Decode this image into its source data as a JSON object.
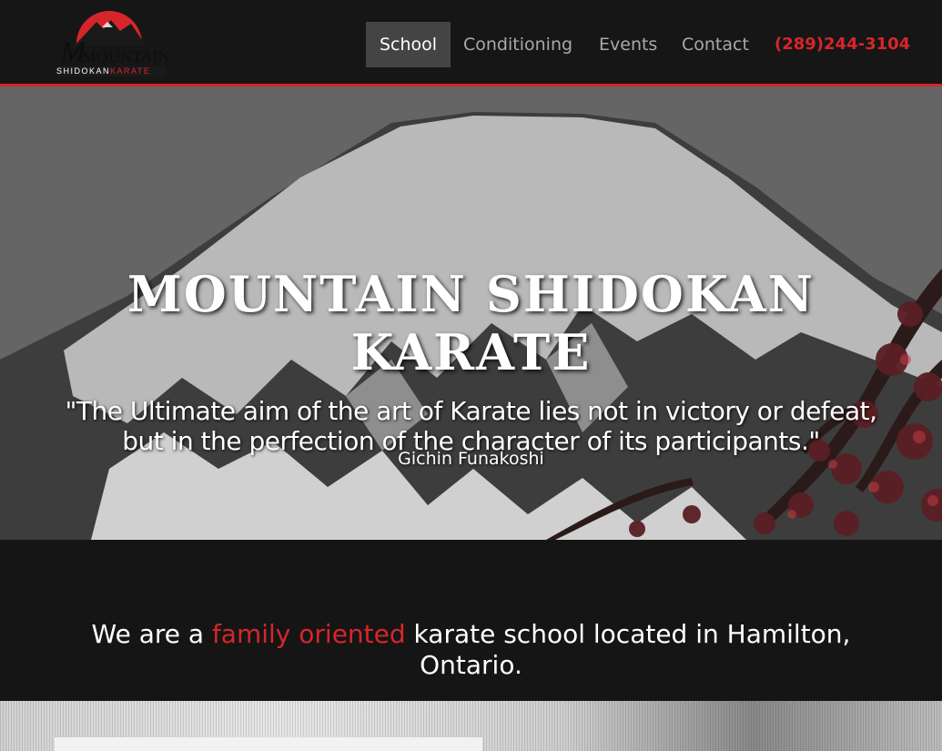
{
  "logo": {
    "wordmark": "MOUNTAIN",
    "sub_left": "SHIDOKAN",
    "sub_right": "KARATE",
    "icon": "mountain-sun-icon"
  },
  "nav": {
    "items": [
      {
        "label": "School",
        "active": true
      },
      {
        "label": "Conditioning",
        "active": false
      },
      {
        "label": "Events",
        "active": false
      },
      {
        "label": "Contact",
        "active": false
      }
    ],
    "phone": "(289)244-3104"
  },
  "hero": {
    "title_line1": "MOUNTAIN SHIDOKAN",
    "title_line2": "KARATE",
    "quote_line1": "\"The Ultimate aim of the art of Karate lies not in victory or defeat,",
    "quote_line2": "but in the perfection of the character of its participants.\"",
    "author": "Gichin Funakoshi"
  },
  "intro": {
    "before": "We are a ",
    "accent": "family oriented",
    "after": " karate school located in Hamilton, Ontario."
  },
  "colors": {
    "accent": "#d6262b",
    "header_bg": "#161616",
    "active_tab_bg": "#444444"
  }
}
